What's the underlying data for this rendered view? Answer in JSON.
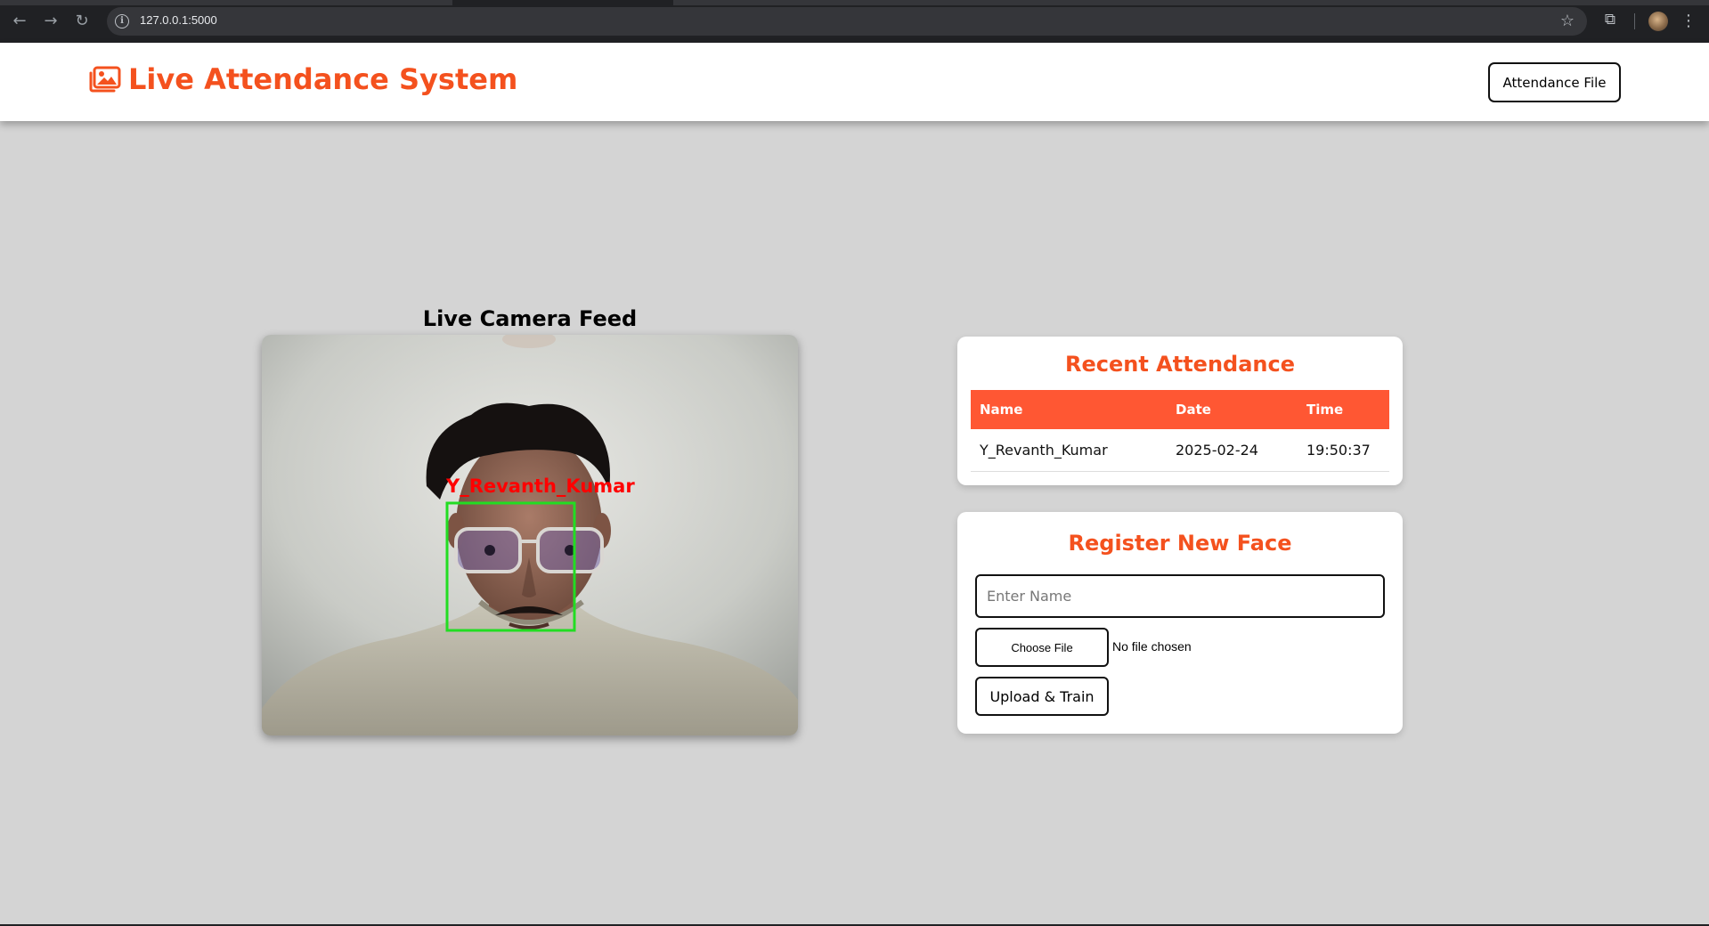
{
  "browser": {
    "url": "127.0.0.1:5000",
    "icons": [
      "back-icon",
      "forward-icon",
      "reload-icon",
      "site-info-icon",
      "bookmark-star-icon",
      "extensions-icon",
      "profile-avatar",
      "more-menu-icon"
    ]
  },
  "header": {
    "title": "Live Attendance System",
    "attendance_file_label": "Attendance File",
    "brand_icon": "images-icon"
  },
  "camera": {
    "title": "Live Camera Feed",
    "detected_label": "Y_Revanth_Kumar"
  },
  "recent": {
    "title": "Recent Attendance",
    "columns": [
      "Name",
      "Date",
      "Time"
    ],
    "rows": [
      {
        "name": "Y_Revanth_Kumar",
        "date": "2025-02-24",
        "time": "19:50:37"
      }
    ]
  },
  "register": {
    "title": "Register New Face",
    "name_placeholder": "Enter Name",
    "name_value": "",
    "choose_file_label": "Choose File",
    "no_file_text": "No file chosen",
    "upload_label": "Upload & Train"
  },
  "colors": {
    "accent": "#f4511e",
    "table_header": "#ff5733",
    "page_bg": "#d4d4d4",
    "detection_box": "#22dd22",
    "detection_label": "#ff0000"
  }
}
